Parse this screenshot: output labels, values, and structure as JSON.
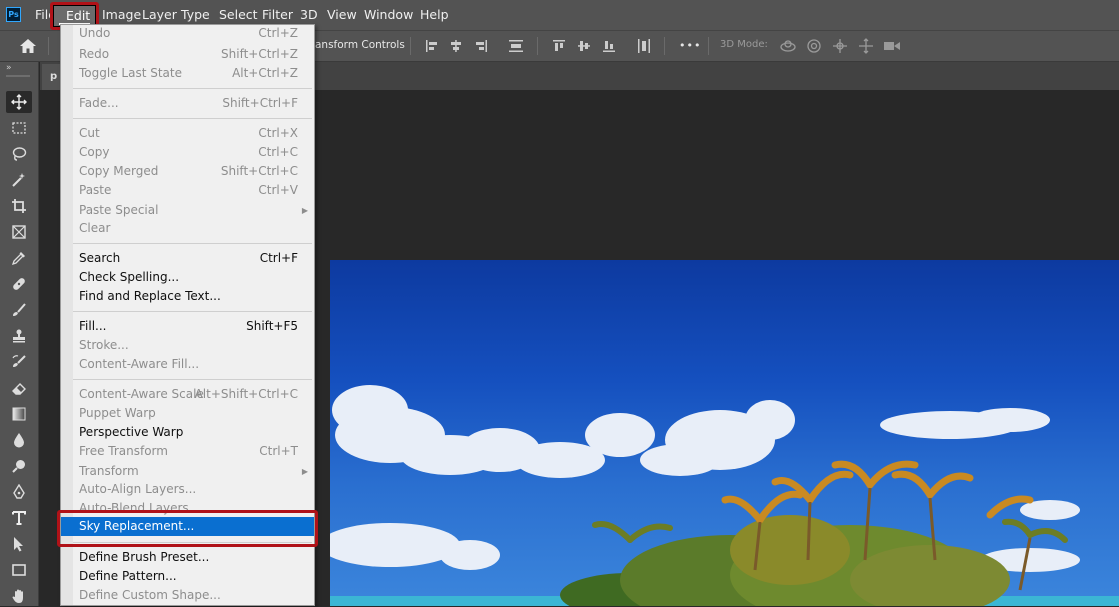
{
  "menubar": {
    "logo": "Ps",
    "items": [
      "File",
      "Edit",
      "Image",
      "Layer",
      "Type",
      "Select",
      "Filter",
      "3D",
      "View",
      "Window",
      "Help"
    ]
  },
  "options_bar": {
    "transform_controls": "ansform Controls",
    "mode_label": "3D Mode:",
    "more": "•••"
  },
  "document_tab": {
    "label": "p"
  },
  "edit_menu": {
    "items": [
      {
        "label": "Undo",
        "shortcut": "Ctrl+Z",
        "enabled": false
      },
      {
        "label": "Redo",
        "shortcut": "Shift+Ctrl+Z",
        "enabled": false
      },
      {
        "label": "Toggle Last State",
        "shortcut": "Alt+Ctrl+Z",
        "enabled": false
      },
      {
        "label": "Fade...",
        "shortcut": "Shift+Ctrl+F",
        "enabled": false
      },
      {
        "label": "Cut",
        "shortcut": "Ctrl+X",
        "enabled": false
      },
      {
        "label": "Copy",
        "shortcut": "Ctrl+C",
        "enabled": false
      },
      {
        "label": "Copy Merged",
        "shortcut": "Shift+Ctrl+C",
        "enabled": false
      },
      {
        "label": "Paste",
        "shortcut": "Ctrl+V",
        "enabled": false
      },
      {
        "label": "Paste Special",
        "shortcut": "",
        "enabled": false
      },
      {
        "label": "Clear",
        "shortcut": "",
        "enabled": false
      },
      {
        "label": "Search",
        "shortcut": "Ctrl+F",
        "enabled": true
      },
      {
        "label": "Check Spelling...",
        "shortcut": "",
        "enabled": true
      },
      {
        "label": "Find and Replace Text...",
        "shortcut": "",
        "enabled": true
      },
      {
        "label": "Fill...",
        "shortcut": "Shift+F5",
        "enabled": true
      },
      {
        "label": "Stroke...",
        "shortcut": "",
        "enabled": false
      },
      {
        "label": "Content-Aware Fill...",
        "shortcut": "",
        "enabled": false
      },
      {
        "label": "Content-Aware Scale",
        "shortcut": "Alt+Shift+Ctrl+C",
        "enabled": false
      },
      {
        "label": "Puppet Warp",
        "shortcut": "",
        "enabled": false
      },
      {
        "label": "Perspective Warp",
        "shortcut": "",
        "enabled": true
      },
      {
        "label": "Free Transform",
        "shortcut": "Ctrl+T",
        "enabled": false
      },
      {
        "label": "Transform",
        "shortcut": "",
        "enabled": false
      },
      {
        "label": "Auto-Align Layers...",
        "shortcut": "",
        "enabled": false
      },
      {
        "label": "Auto-Blend Layers...",
        "shortcut": "",
        "enabled": false
      },
      {
        "label": "Sky Replacement...",
        "shortcut": "",
        "enabled": true,
        "highlighted": true
      },
      {
        "label": "Define Brush Preset...",
        "shortcut": "",
        "enabled": true
      },
      {
        "label": "Define Pattern...",
        "shortcut": "",
        "enabled": true
      },
      {
        "label": "Define Custom Shape...",
        "shortcut": "",
        "enabled": false
      }
    ]
  },
  "colors": {
    "highlight": "#0a6fd0",
    "annotation_red": "#b01218",
    "menubar_bg": "#535353",
    "workspace_bg": "#282828"
  }
}
